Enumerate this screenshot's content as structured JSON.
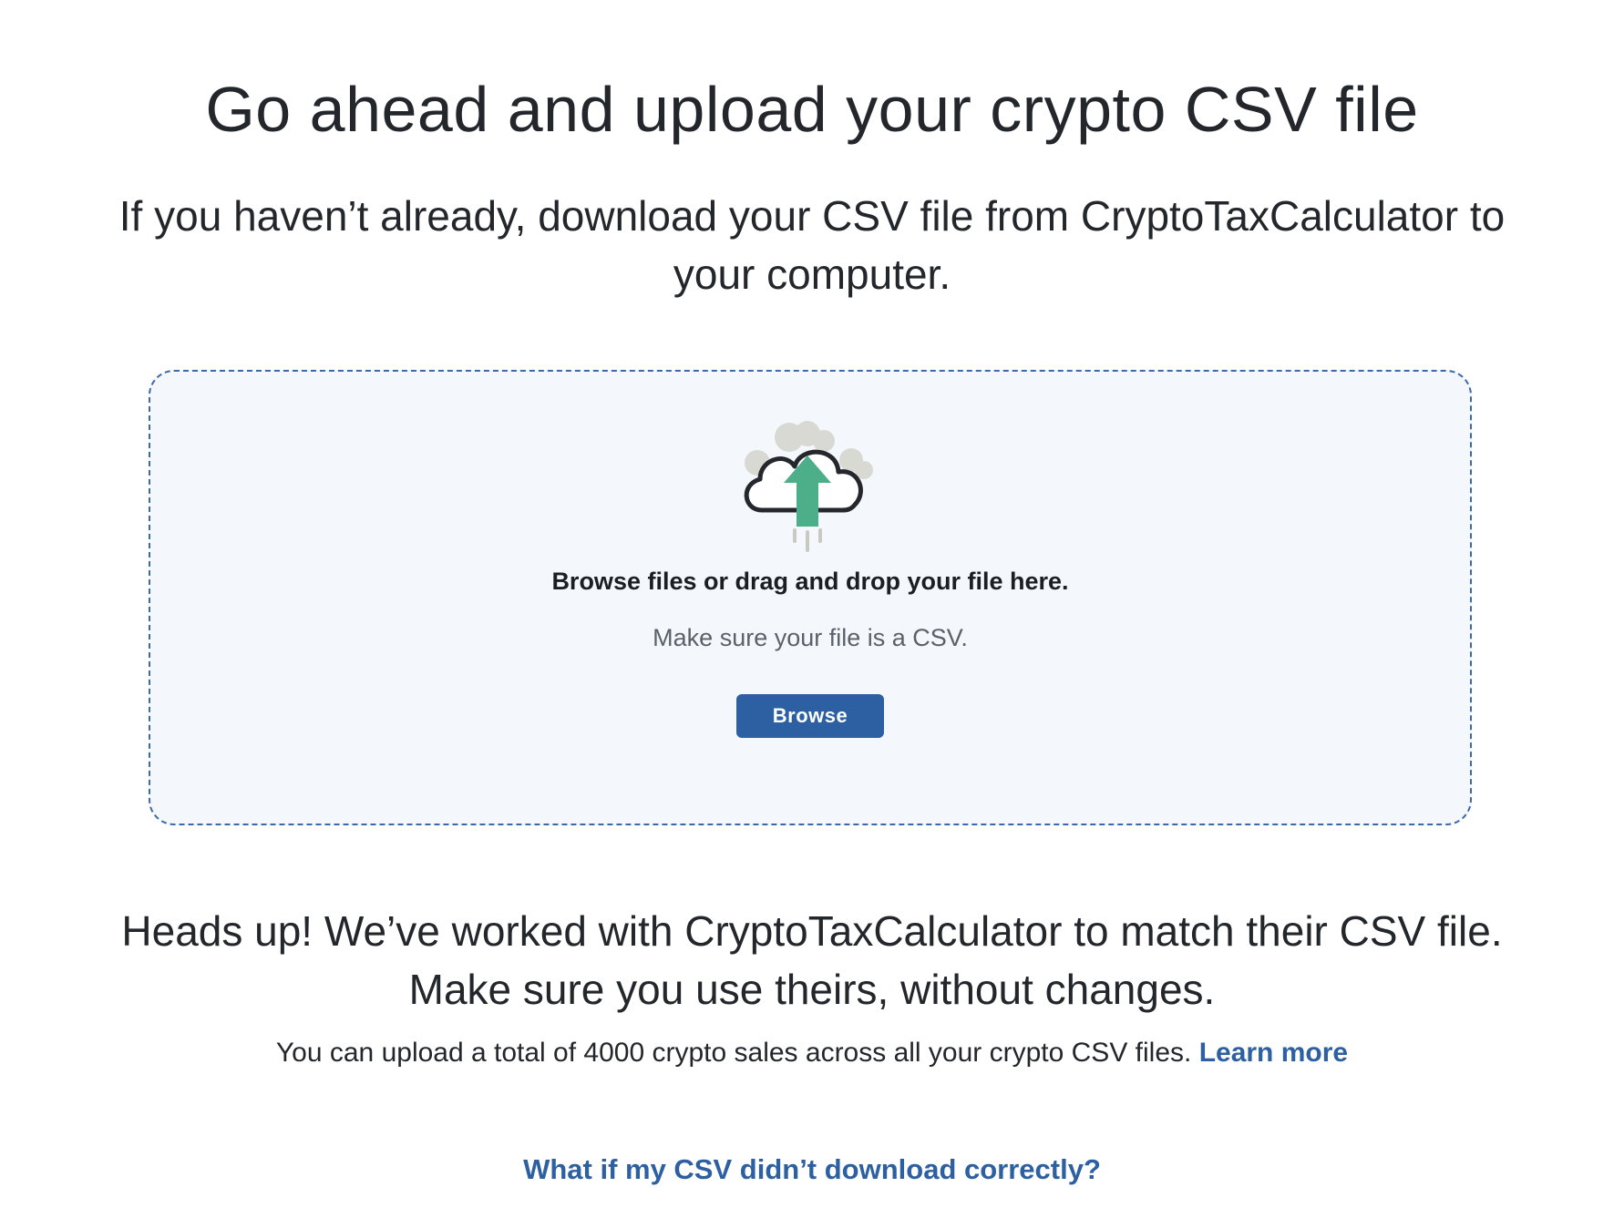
{
  "header": {
    "title": "Go ahead and upload your crypto CSV file",
    "subtitle": "If you haven’t already, download your CSV file from CryptoTaxCalculator to your computer."
  },
  "dropzone": {
    "icon": "cloud-upload-icon",
    "primary_text": "Browse files or drag and drop your file here.",
    "secondary_text": "Make sure your file is a CSV.",
    "browse_label": "Browse"
  },
  "notice": {
    "heads_up": "Heads up! We’ve worked with CryptoTaxCalculator to match their CSV file. Make sure you use theirs, without changes.",
    "limit_text": "You can upload a total of 4000 crypto sales across all your crypto CSV files. ",
    "learn_more_label": "Learn more"
  },
  "help": {
    "link_label": "What if my CSV didn’t download correctly?"
  },
  "colors": {
    "accent": "#2d5fa3",
    "dropzone_bg": "#f4f7fb",
    "arrow": "#4caf8a"
  }
}
